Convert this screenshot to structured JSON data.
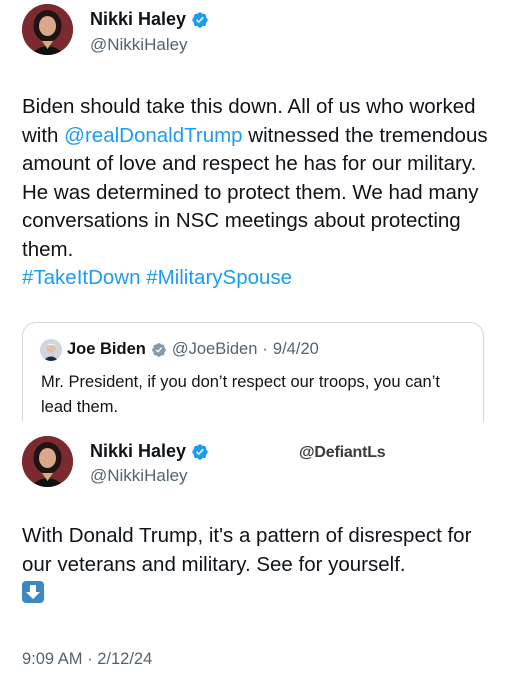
{
  "tweet1": {
    "author_name": "Nikki Haley",
    "author_handle": "@NikkiHaley",
    "text_part1": "Biden should take this down. All of us who worked with ",
    "mention": "@realDonaldTrump",
    "text_part2": " witnessed the tremendous amount of love and respect he has for our military. He was determined to protect them. We had many conversations in NSC meetings  about protecting them. ",
    "hashtag1": "#TakeItDown",
    "hashtag2": "#MilitarySpouse"
  },
  "quoted_tweet": {
    "author_name": "Joe Biden",
    "author_handle": "@JoeBiden",
    "separator": "·",
    "date": "9/4/20",
    "text": "Mr. President, if you don’t respect our troops, you can’t lead them."
  },
  "tweet2": {
    "author_name": "Nikki Haley",
    "author_handle": "@NikkiHaley",
    "text": "With Donald Trump, it's a pattern of disrespect for our veterans and military. See for yourself.",
    "emoji": "down-arrow-emoji",
    "timestamp": "9:09 AM · 2/12/24"
  },
  "watermark": "@DefiantLs",
  "colors": {
    "link": "#1d9bf0",
    "verified": "#1d9bf0",
    "secondary_text": "#536471",
    "border": "#cfd9de"
  }
}
